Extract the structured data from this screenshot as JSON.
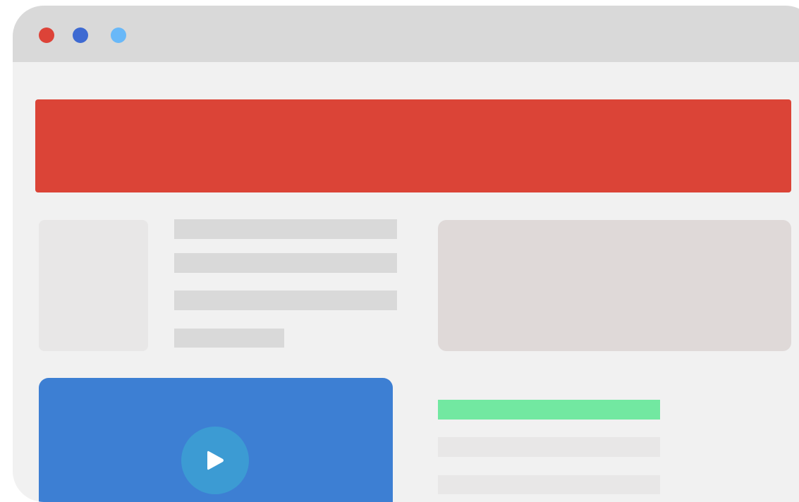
{
  "colors": {
    "close_dot": "#dd4338",
    "minimize_dot": "#3e6ad2",
    "maximize_dot": "#69b8f8",
    "banner": "#db4437",
    "placeholder_bar": "#d9d9d9",
    "thumbnail": "#e8e7e7",
    "media_card": "#dfd9d8",
    "video_panel": "#3d7fd3",
    "play_button": "#3c9bd3",
    "play_icon": "#ffffff",
    "accent_bar": "#72e8a1",
    "light_bar": "#e8e7e7"
  },
  "icons": {
    "play": "play-icon"
  }
}
